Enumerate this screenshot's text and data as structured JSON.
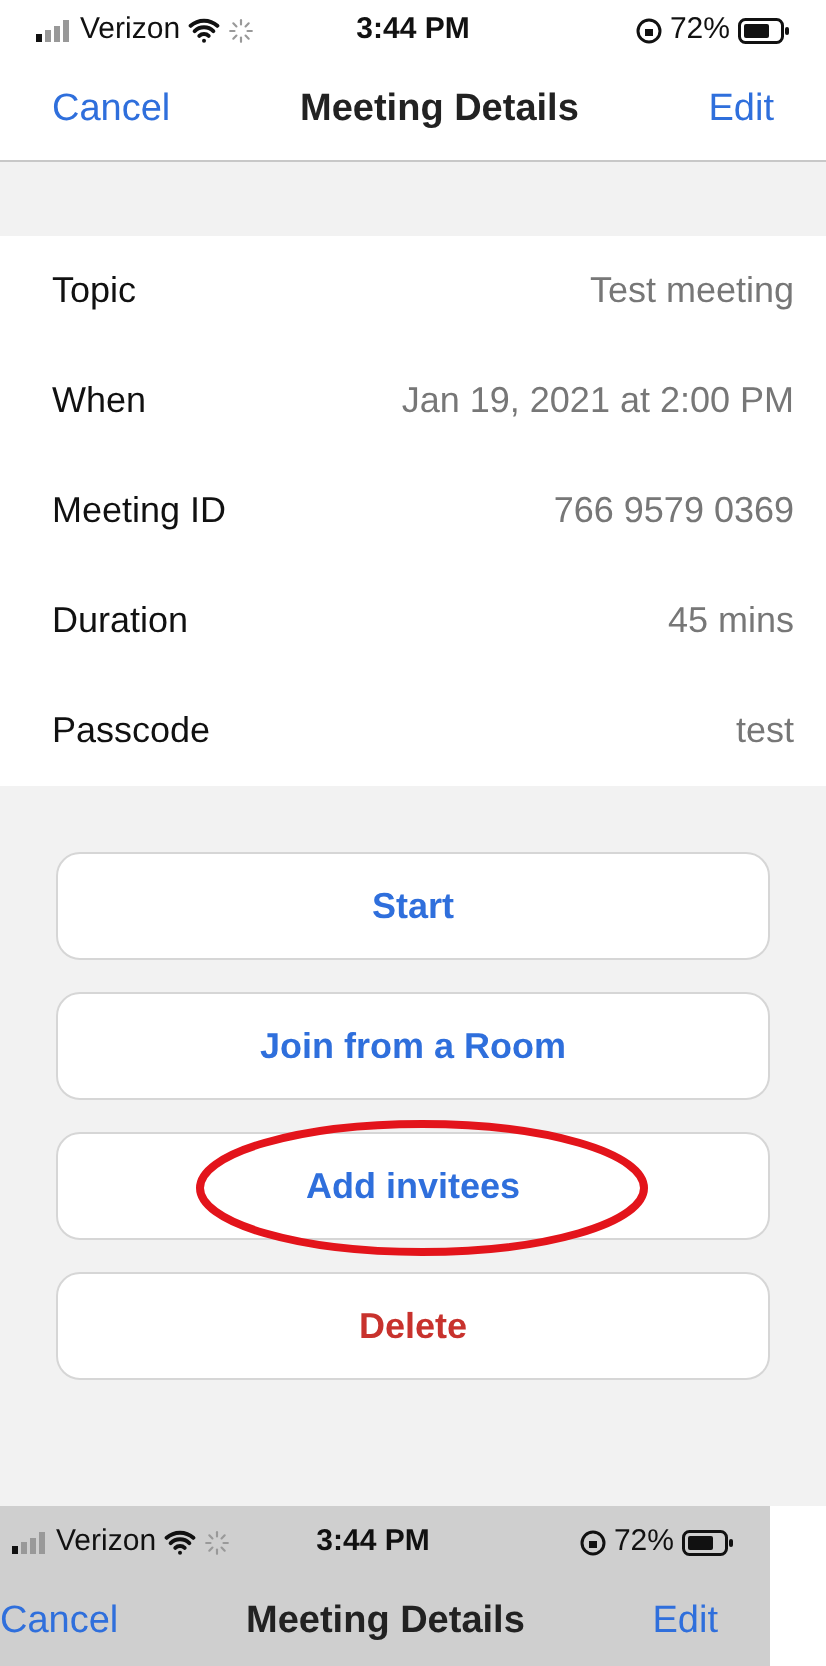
{
  "status_bar": {
    "carrier": "Verizon",
    "time": "3:44 PM",
    "battery": "72%"
  },
  "nav_bar": {
    "left": "Cancel",
    "title": "Meeting Details",
    "right": "Edit"
  },
  "details": [
    {
      "label": "Topic",
      "value": "Test meeting"
    },
    {
      "label": "When",
      "value": "Jan 19, 2021 at 2:00 PM"
    },
    {
      "label": "Meeting ID",
      "value": "766 9579 0369"
    },
    {
      "label": "Duration",
      "value": "45 mins"
    },
    {
      "label": "Passcode",
      "value": "test"
    }
  ],
  "buttons": [
    {
      "label": "Start",
      "kind": "default",
      "circled": false
    },
    {
      "label": "Join from a Room",
      "kind": "default",
      "circled": false
    },
    {
      "label": "Add invitees",
      "kind": "default",
      "circled": true
    },
    {
      "label": "Delete",
      "kind": "destructive",
      "circled": false
    }
  ],
  "overlay_copy": {
    "status_bar": {
      "carrier": "Verizon",
      "time": "3:44 PM",
      "battery": "72%"
    },
    "nav_bar": {
      "left": "Cancel",
      "title": "Meeting Details",
      "right": "Edit"
    }
  }
}
